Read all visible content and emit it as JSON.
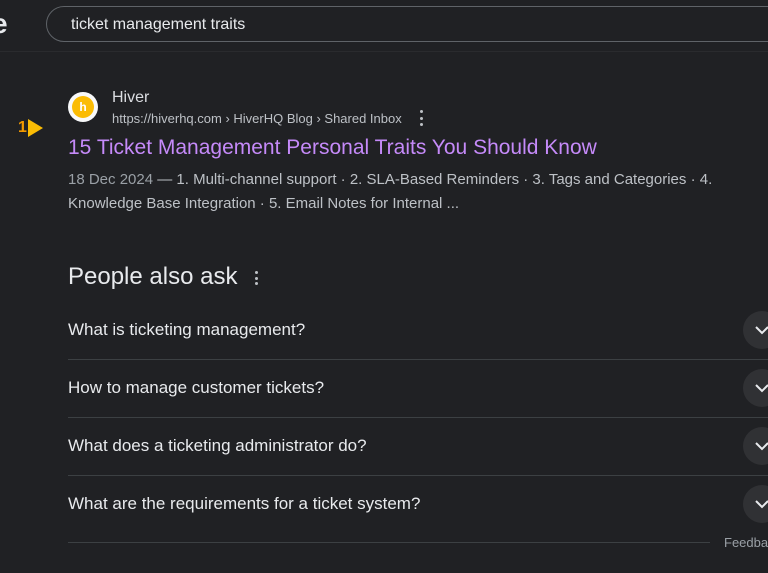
{
  "search": {
    "query": "ticket management traits",
    "logo_fragment": "e"
  },
  "marker": {
    "number": "1"
  },
  "result": {
    "site_name": "Hiver",
    "url": "https://hiverhq.com › HiverHQ Blog › Shared Inbox",
    "title": "15 Ticket Management Personal Traits You Should Know",
    "date": "18 Dec 2024",
    "snippet": " — 1. Multi-channel support · 2. SLA-Based Reminders · 3. Tags and Categories · 4. Knowledge Base Integration · 5. Email Notes for Internal ...",
    "favicon_letter": "h"
  },
  "people_also_ask": {
    "title": "People also ask",
    "questions": [
      "What is ticketing management?",
      "How to manage customer tickets?",
      "What does a ticketing administrator do?",
      "What are the requirements for a ticket system?"
    ]
  },
  "footer": {
    "feedback": "Feedback"
  },
  "colors": {
    "background": "#202124",
    "link_visited": "#c58af9",
    "marker": "#fbbc04"
  }
}
